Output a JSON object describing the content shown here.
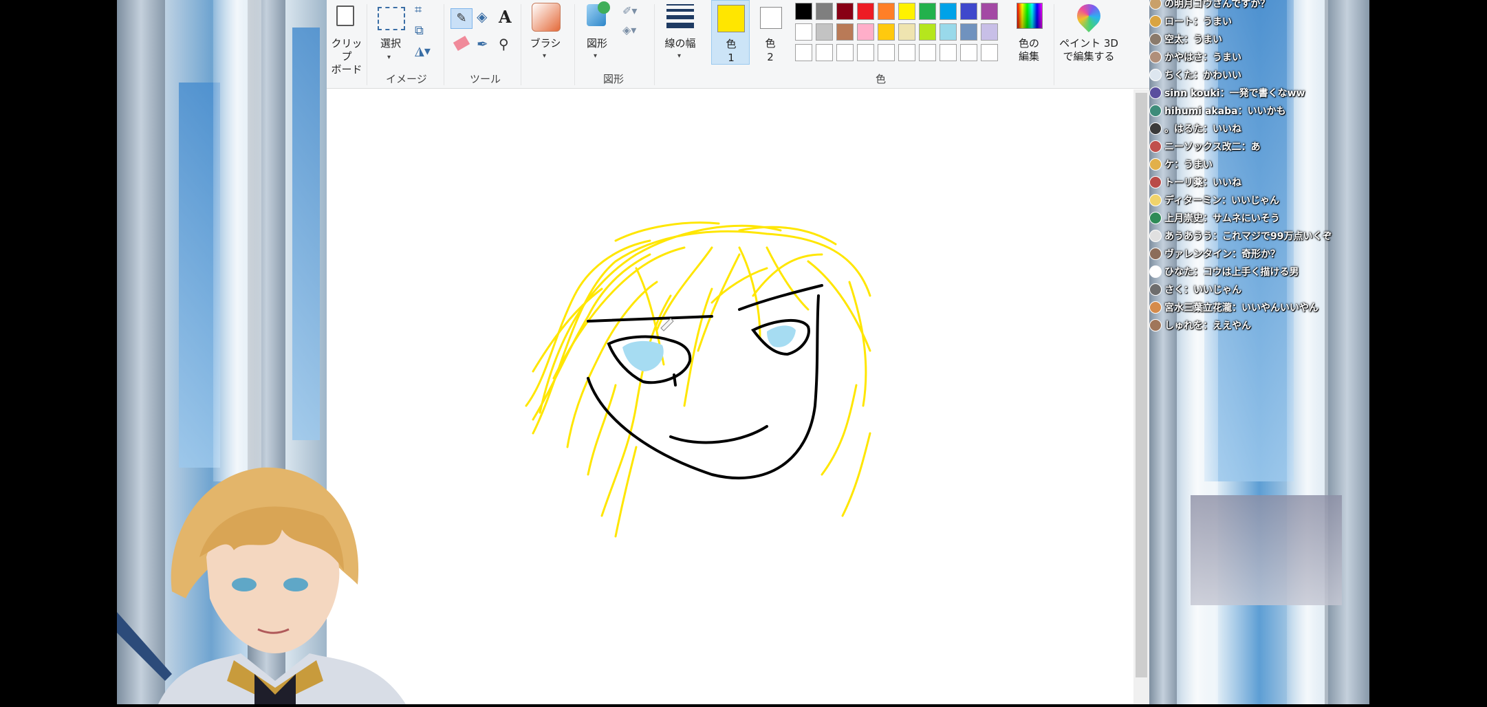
{
  "ribbon": {
    "clipboard_label": "クリップ\nボード",
    "select_label": "選択",
    "image_group": "イメージ",
    "tools_group": "ツール",
    "brush_label": "ブラシ",
    "shapes_label": "図形",
    "shapes_group": "図形",
    "size_label": "線の幅",
    "color1_label": "色",
    "color1_num": "1",
    "color2_label": "色",
    "color2_num": "2",
    "colors_group": "色",
    "edit_colors_label": "色の\n編集",
    "paint3d_label": "ペイント 3D\nで編集する"
  },
  "palette": {
    "row1": [
      "#000000",
      "#7f7f7f",
      "#880015",
      "#ed1c24",
      "#ff7f27",
      "#fff200",
      "#22b14c",
      "#00a2e8",
      "#3f48cc",
      "#a349a4"
    ],
    "row2": [
      "#ffffff",
      "#c3c3c3",
      "#b97a57",
      "#ffaec9",
      "#ffc90e",
      "#efe4b0",
      "#b5e61d",
      "#99d9ea",
      "#7092be",
      "#c8bfe7"
    ],
    "row3": [
      "#ffffff",
      "#ffffff",
      "#ffffff",
      "#ffffff",
      "#ffffff",
      "#ffffff",
      "#ffffff",
      "#ffffff",
      "#ffffff",
      "#ffffff"
    ],
    "color1": "#ffe600",
    "color2": "#ffffff"
  },
  "chat": [
    {
      "text": "の明月ゴウさんですか？",
      "avatar": "#c9a06a"
    },
    {
      "text": "ロート：うまい",
      "avatar": "#d9a441"
    },
    {
      "text": "空太：うまい",
      "avatar": "#8a7a6b"
    },
    {
      "text": "かやはさ：うまい",
      "avatar": "#b08f7a"
    },
    {
      "text": "ちくた：かわいい",
      "avatar": "#dde6ef"
    },
    {
      "text": "sinn kouki：一発で書くなww",
      "avatar": "#5a4f9e"
    },
    {
      "text": "hihumi akaba：いいかも",
      "avatar": "#3d8c7a"
    },
    {
      "text": "。はるた：いいね",
      "avatar": "#3b3b3b"
    },
    {
      "text": "ニーソックス改二：あ",
      "avatar": "#c0504d"
    },
    {
      "text": "ケ：うまい",
      "avatar": "#e2b04a"
    },
    {
      "text": "トーリ薬：いいね",
      "avatar": "#b94a48"
    },
    {
      "text": "ディターミン：いいじゃん",
      "avatar": "#f0d36b"
    },
    {
      "text": "上月崇史：サムネにいそう",
      "avatar": "#2e8b57"
    },
    {
      "text": "あうあうう：これマジで99万点いくぞ",
      "avatar": "#e0e0e0"
    },
    {
      "text": "ヴァレンタイン：奇形か？",
      "avatar": "#8c6d5a"
    },
    {
      "text": "ひなた：コウは上手く描ける男",
      "avatar": "#ffffff"
    },
    {
      "text": "さく：いいじゃん",
      "avatar": "#6d6d6d"
    },
    {
      "text": "宮水三葉立花瀧：いいやんいいやん",
      "avatar": "#d58b4b"
    },
    {
      "text": "しゅれを：ええやん",
      "avatar": "#a0765a"
    }
  ]
}
